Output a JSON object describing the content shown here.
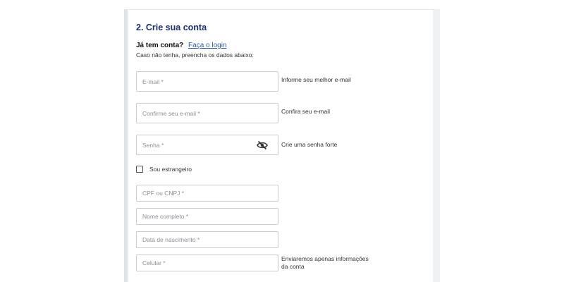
{
  "form": {
    "section_title": "2. Crie sua conta",
    "login_prompt": "Já tem conta?",
    "login_link": "Faça o login",
    "hint": "Caso não tenha, preencha os dados abaixo:",
    "fields": {
      "email": {
        "placeholder": "E-mail *",
        "value": "",
        "note": "Informe seu melhor e-mail"
      },
      "confirm_email": {
        "placeholder": "Confirme seu e-mail *",
        "value": "",
        "note": "Confira seu e-mail"
      },
      "password": {
        "placeholder": "Senha *",
        "value": "",
        "note": "Crie uma senha forte",
        "toggle_icon": "eye-slash-icon"
      },
      "foreigner": {
        "label": "Sou estrangeiro",
        "checked": false
      },
      "cpf_cnpj": {
        "placeholder": "CPF ou CNPJ *",
        "value": ""
      },
      "full_name": {
        "placeholder": "Nome completo *",
        "value": ""
      },
      "birth_date": {
        "placeholder": "Data de nascimento *",
        "value": ""
      },
      "phone": {
        "placeholder": "Celular *",
        "value": "",
        "note_line1": "Enviaremos apenas informações",
        "note_line2": "da conta"
      }
    }
  },
  "colors": {
    "title": "#1c2f6b",
    "link": "#2c5aa0",
    "field_border": "#c9cdd2"
  }
}
